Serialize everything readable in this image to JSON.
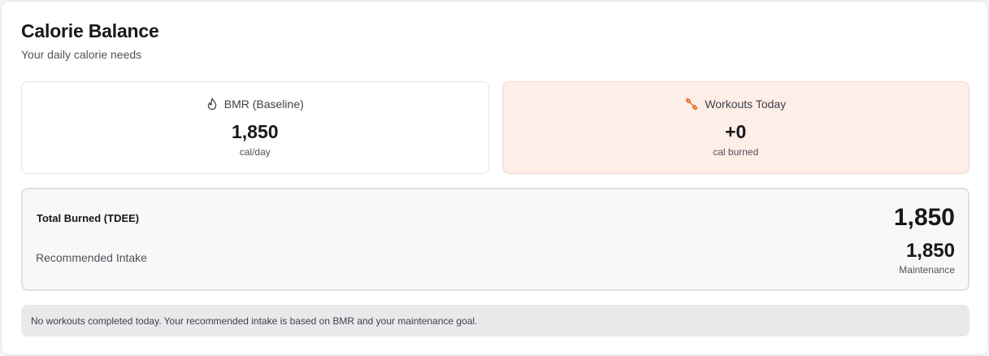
{
  "header": {
    "title": "Calorie Balance",
    "subtitle": "Your daily calorie needs"
  },
  "bmr": {
    "icon": "flame-icon",
    "label": "BMR (Baseline)",
    "value": "1,850",
    "unit": "cal/day"
  },
  "workouts": {
    "icon": "dumbbell-icon",
    "label": "Workouts Today",
    "value": "+0",
    "unit": "cal burned",
    "accent_bg": "#fdeee8",
    "icon_color": "#ea580c"
  },
  "summary": {
    "tdee_label": "Total Burned (TDEE)",
    "tdee_value": "1,850",
    "intake_label": "Recommended Intake",
    "intake_value": "1,850",
    "intake_note": "Maintenance"
  },
  "note": {
    "text": "No workouts completed today. Your recommended intake is based on BMR and your maintenance goal."
  }
}
